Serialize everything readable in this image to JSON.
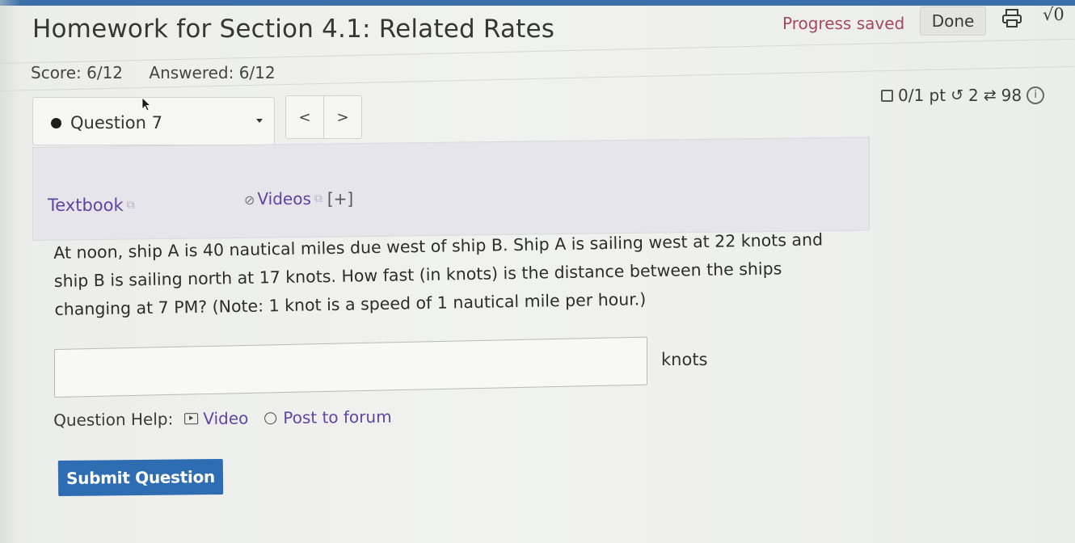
{
  "header": {
    "title": "Homework for Section 4.1: Related Rates",
    "progress_status": "Progress saved",
    "done_label": "Done",
    "print_icon": "printer-icon",
    "math_icon": "√0"
  },
  "summary": {
    "score": "Score: 6/12",
    "answered": "Answered: 6/12"
  },
  "question_nav": {
    "selected": "Question 7",
    "prev": "<",
    "next": ">"
  },
  "question_meta": {
    "points": "0/1 pt",
    "attempts": "2",
    "versions": "98"
  },
  "resources": {
    "textbook": "Textbook",
    "videos": "Videos",
    "expand": "[+]"
  },
  "question": {
    "lines": [
      "At noon, ship A is 40 nautical miles due west of ship B. Ship A is sailing west at 22 knots and",
      "ship B is sailing north at 17 knots. How fast (in knots) is the distance between the ships",
      "changing at 7 PM? (Note: 1 knot is a speed of 1 nautical mile per hour.)"
    ],
    "answer_value": "",
    "units": "knots"
  },
  "help": {
    "label": "Question Help:",
    "video": "Video",
    "forum": "Post to forum"
  },
  "actions": {
    "submit": "Submit Question"
  },
  "colors": {
    "accent_blue": "#2f6db3",
    "link_purple": "#5a47a3",
    "progress_red": "#a5495b"
  }
}
